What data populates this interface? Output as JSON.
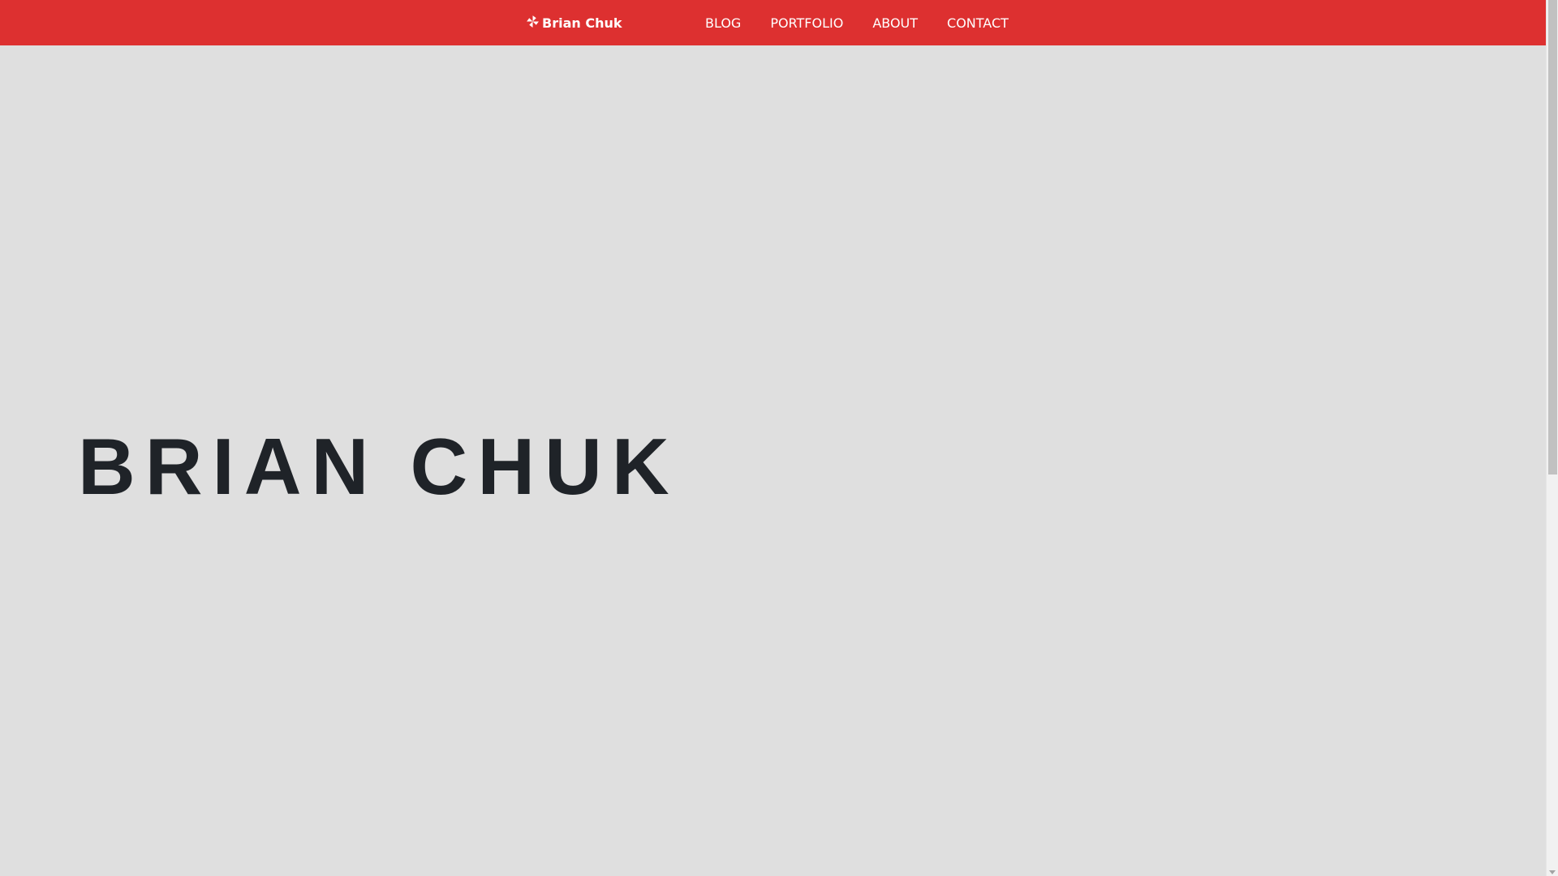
{
  "navbar": {
    "brand_icon": "pinwheel-icon",
    "brand_label": "Brian Chuk",
    "links": [
      {
        "label": "BLOG"
      },
      {
        "label": "PORTFOLIO"
      },
      {
        "label": "ABOUT"
      },
      {
        "label": "CONTACT"
      }
    ],
    "background_color": "#dd3030",
    "text_color": "#ffffff"
  },
  "hero": {
    "title": "BRIAN CHUK",
    "background_color": "#dfdfdf",
    "title_color": "#1f2328"
  },
  "scrollbar": {
    "icons": [
      "arrow-down-icon"
    ]
  }
}
